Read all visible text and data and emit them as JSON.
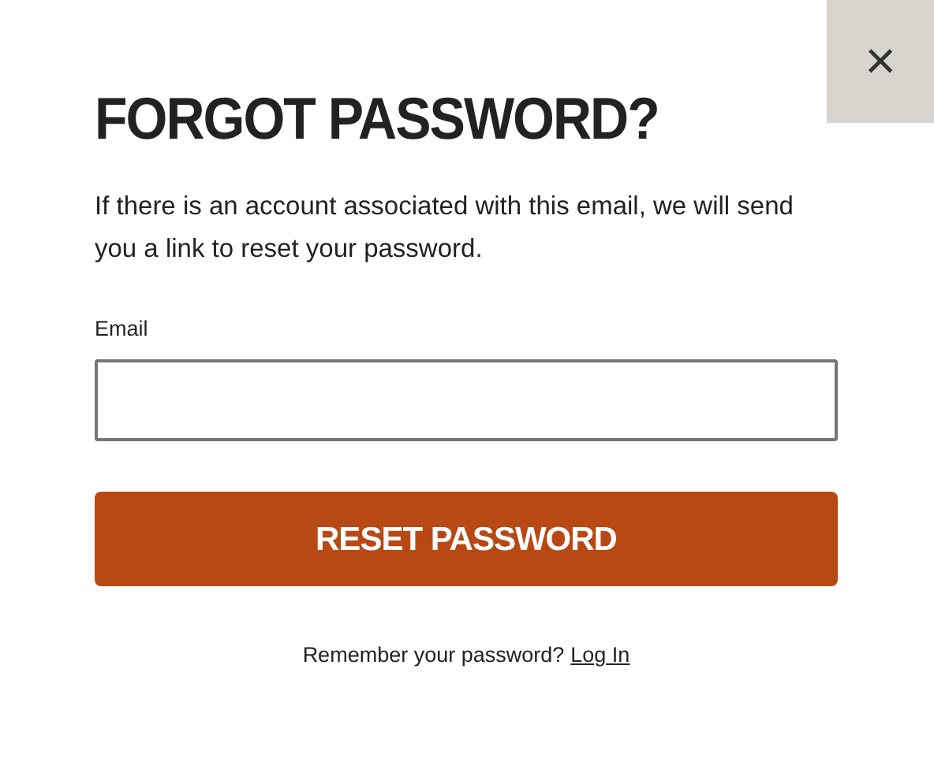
{
  "close_button": {
    "label": "×"
  },
  "title": "FORGOT PASSWORD?",
  "description": "If there is an account associated with this email, we will send you a link to reset your password.",
  "email_field": {
    "label": "Email"
  },
  "submit_button": {
    "label": "RESET PASSWORD"
  },
  "footer": {
    "text": "Remember your password?",
    "link": "Log In"
  }
}
